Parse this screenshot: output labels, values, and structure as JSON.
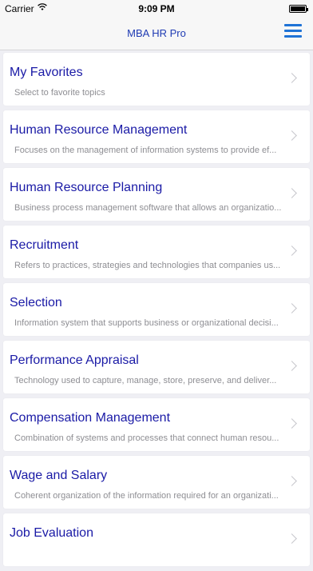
{
  "status_bar": {
    "carrier": "Carrier",
    "time": "9:09 PM"
  },
  "nav": {
    "title": "MBA HR Pro"
  },
  "items": [
    {
      "title": "My Favorites",
      "subtitle": "Select to favorite topics"
    },
    {
      "title": "Human Resource Management",
      "subtitle": "Focuses on the management of information systems to provide ef..."
    },
    {
      "title": "Human Resource Planning",
      "subtitle": "Business process management software that allows an organizatio..."
    },
    {
      "title": "Recruitment",
      "subtitle": "Refers to practices, strategies and technologies that companies us..."
    },
    {
      "title": "Selection",
      "subtitle": "Information system that supports business or organizational decisi..."
    },
    {
      "title": "Performance Appraisal",
      "subtitle": "Technology used to capture, manage, store, preserve, and deliver..."
    },
    {
      "title": "Compensation Management",
      "subtitle": "Combination of systems and processes that connect human resou..."
    },
    {
      "title": "Wage and Salary",
      "subtitle": "Coherent organization of the information required for an organizati..."
    },
    {
      "title": "Job Evaluation",
      "subtitle": ""
    }
  ]
}
